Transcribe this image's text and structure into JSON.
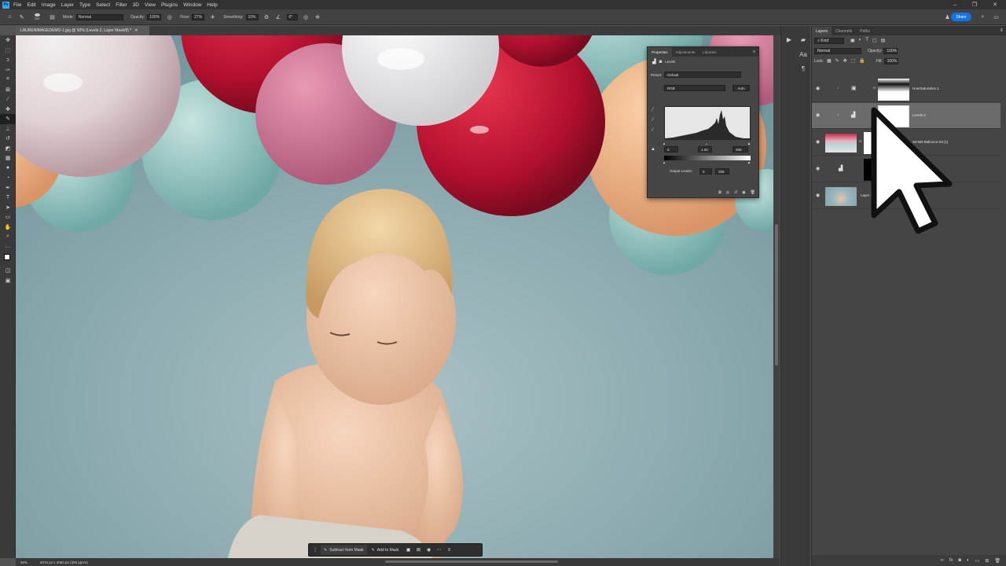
{
  "menubar": {
    "logo": "Ps",
    "items": [
      "File",
      "Edit",
      "Image",
      "Layer",
      "Type",
      "Select",
      "Filter",
      "3D",
      "View",
      "Plugins",
      "Window",
      "Help"
    ]
  },
  "options": {
    "mode_label": "Mode:",
    "mode_value": "Normal",
    "opacity_label": "Opacity:",
    "opacity_value": "100%",
    "flow_label": "Flow:",
    "flow_value": "27%",
    "smoothing_label": "Smoothing:",
    "smoothing_value": "10%",
    "angle_value": "0°",
    "brush_size": "324",
    "share_label": "Share"
  },
  "document": {
    "tab_title": "LAURENIMAGEDEMO-1.jpg @ 50% (Levels 2, Layer Mask/8) *",
    "zoom": "50%",
    "dimensions": "6076 px x 4050 px (300 ppcm)"
  },
  "layers_panel": {
    "tabs": [
      "Layers",
      "Channels",
      "Paths"
    ],
    "filter_value": "Kind",
    "blend_mode": "Normal",
    "opacity_label": "Opacity:",
    "opacity_value": "100%",
    "lock_label": "Lock:",
    "fill_label": "Fill:",
    "fill_value": "100%",
    "layers": [
      {
        "name": "Hue/Saturation 1"
      },
      {
        "name": "Levels 2"
      },
      {
        "name": "3D-BB-Balloons-S3 [1]"
      },
      {
        "name": ""
      },
      {
        "name": "Layer 1"
      }
    ]
  },
  "properties": {
    "tabs": [
      "Properties",
      "Adjustments",
      "Libraries"
    ],
    "adjustment_name": "Levels",
    "preset_label": "Preset:",
    "preset_value": "Default",
    "channel": "RGB",
    "auto_label": "Auto",
    "input_black": "0",
    "input_mid": "1.00",
    "input_white": "255",
    "output_label": "Output Levels:",
    "output_black": "0",
    "output_white": "255"
  },
  "mask_toolbar": {
    "subtract": "Subtract from Mask",
    "add": "Add to Mask"
  },
  "colors": {
    "accent": "#1473e6",
    "ps_blue": "#31a8ff",
    "panel_bg": "#454545",
    "backdrop": "#93b2b8"
  }
}
